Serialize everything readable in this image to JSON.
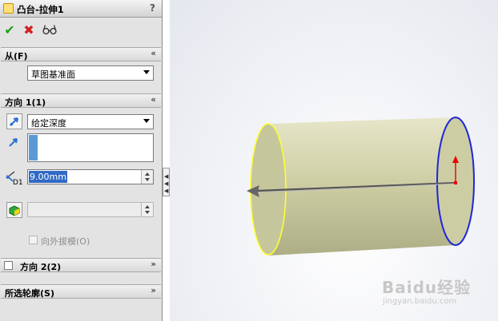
{
  "title_bar": {
    "title": "凸台-拉伸1",
    "help": "?"
  },
  "actions": {
    "ok_icon": "check-icon",
    "cancel_icon": "x-icon",
    "preview_icon": "glasses-icon"
  },
  "from_section": {
    "label": "从(F)",
    "chevron": "«",
    "selected": "草图基准面"
  },
  "direction1": {
    "label": "方向 1(1)",
    "chevron": "«",
    "end_condition": "给定深度",
    "depth": "9.00mm",
    "depth_label": "D1",
    "draft_label": "向外拔模(O)"
  },
  "direction2": {
    "label": "方向 2(2)",
    "chevron": "»"
  },
  "contours": {
    "label": "所选轮廓(S)",
    "chevron": "»"
  },
  "watermark": {
    "brand": "Baidu经验",
    "url": "jingyan.baidu.com"
  },
  "colors": {
    "cylinder_body": "#cfcfa6",
    "front_edge": "#ffff33",
    "back_edge": "#1f27d8",
    "arrow_red": "#e60000"
  }
}
